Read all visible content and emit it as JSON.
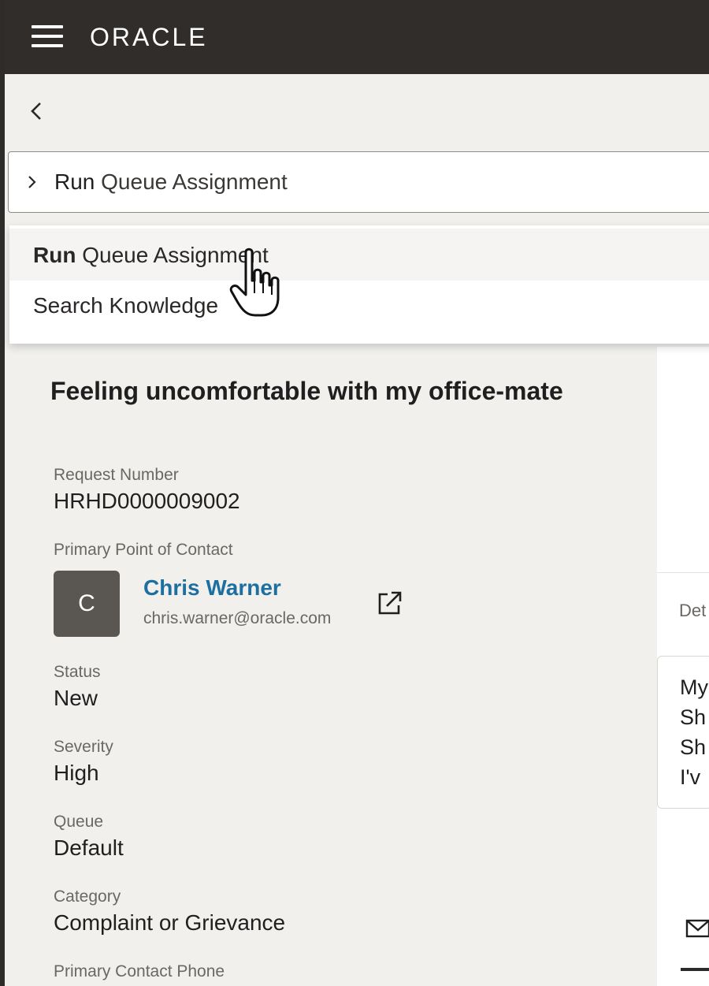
{
  "app": {
    "logo": "ORACLE"
  },
  "search": {
    "value_bold": "Run",
    "value_rest": " Queue Assignment"
  },
  "dropdown": {
    "items": [
      {
        "bold": "Run",
        "rest": " Queue Assignment",
        "highlighted": true
      },
      {
        "bold": "",
        "rest": "Search Knowledge",
        "highlighted": false
      }
    ]
  },
  "request": {
    "title": "Feeling uncomfortable with my office-mate",
    "fields": {
      "request_number": {
        "label": "Request Number",
        "value": "HRHD0000009002"
      },
      "primary_contact": {
        "label": "Primary Point of Contact",
        "initial": "C",
        "name": "Chris Warner",
        "email": "chris.warner@oracle.com"
      },
      "status": {
        "label": "Status",
        "value": "New"
      },
      "severity": {
        "label": "Severity",
        "value": "High"
      },
      "queue": {
        "label": "Queue",
        "value": "Default"
      },
      "category": {
        "label": "Category",
        "value": "Complaint or Grievance"
      },
      "phone": {
        "label": "Primary Contact Phone"
      }
    }
  },
  "right_panel": {
    "details_label": "Det",
    "text_lines": [
      "My",
      "Sh",
      "Sh",
      "I'v"
    ]
  },
  "icons": {
    "menu": "hamburger-icon",
    "back": "chevron-left-icon",
    "expand": "chevron-right-icon",
    "pointer": "hand-cursor-icon",
    "external": "external-link-icon",
    "mail": "mail-icon"
  },
  "colors": {
    "header": "#312d2a",
    "link": "#1d6fa0",
    "page": "#f1f0ed"
  }
}
